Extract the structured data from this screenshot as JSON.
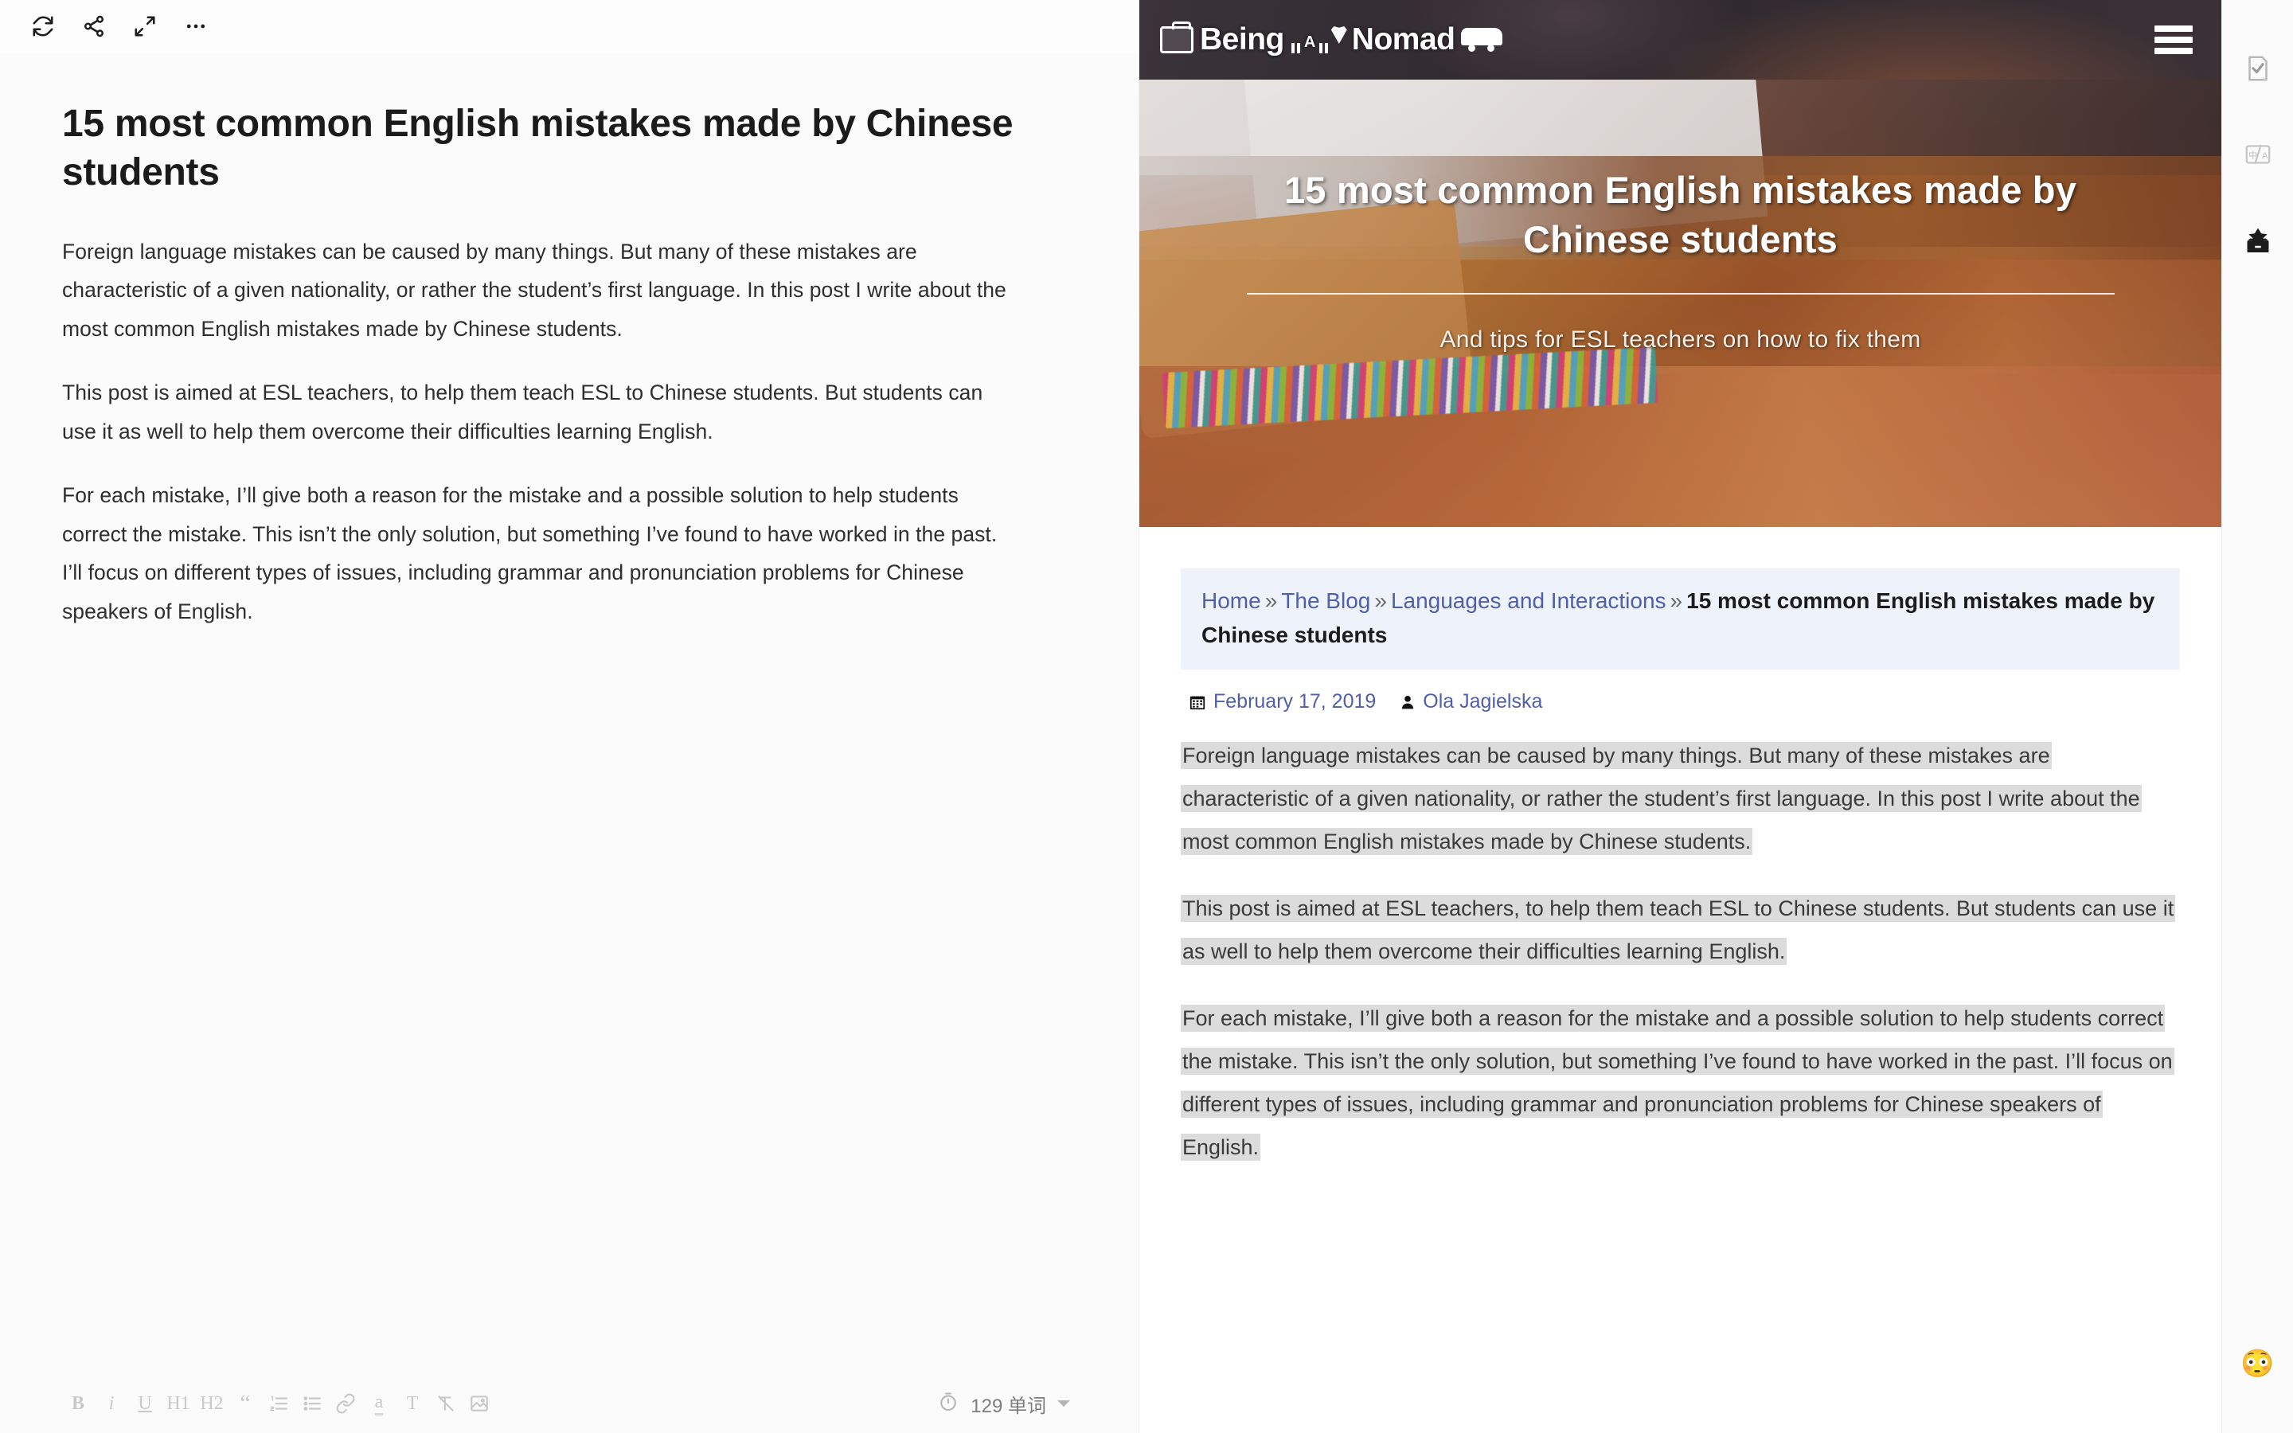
{
  "editor": {
    "toolbar_top": [
      {
        "name": "sync-icon",
        "label": "Sync"
      },
      {
        "name": "share-icon",
        "label": "Share"
      },
      {
        "name": "fullscreen-icon",
        "label": "Fullscreen"
      },
      {
        "name": "more-options-icon",
        "label": "More"
      }
    ],
    "document": {
      "title": "15 most common English mistakes made by Chinese students",
      "paragraphs": [
        "Foreign language mistakes can be caused by many things. But many of these mistakes are characteristic of a given nationality, or rather the student’s first language. In this post I write about the most common English mistakes made by Chinese students.",
        "This post is aimed at ESL teachers, to help them teach ESL to Chinese students. But students can use it as well to help them overcome their difficulties learning English.",
        "For each mistake, I’ll give both a reason for the mistake and a possible solution to help students correct the mistake. This isn’t the only solution, but something I’ve found to have worked in the past. I’ll focus on different types of issues, including grammar and pronunciation problems for Chinese speakers of English."
      ]
    },
    "format_toolbar": [
      {
        "name": "bold-button",
        "label": "B"
      },
      {
        "name": "italic-button",
        "label": "i"
      },
      {
        "name": "underline-button",
        "label": "U"
      },
      {
        "name": "heading-1-button",
        "label": "H1"
      },
      {
        "name": "heading-2-button",
        "label": "H2"
      },
      {
        "name": "blockquote-button",
        "label": "“"
      },
      {
        "name": "ordered-list-button",
        "label": "ordered-list"
      },
      {
        "name": "unordered-list-button",
        "label": "unordered-list"
      },
      {
        "name": "link-button",
        "label": "link"
      },
      {
        "name": "highlight-button",
        "label": "a"
      },
      {
        "name": "text-color-button",
        "label": "T"
      },
      {
        "name": "clear-format-button",
        "label": "clear"
      },
      {
        "name": "insert-image-button",
        "label": "image"
      }
    ],
    "status": {
      "word_count": "129 单词",
      "timer_icon": "timer-icon"
    }
  },
  "preview": {
    "site": {
      "logo_text_1": "Being",
      "logo_text_a": "A",
      "logo_text_2": "Nomad",
      "menu_icon": "hamburger-menu-icon"
    },
    "hero": {
      "title": "15 most common English mistakes made by Chinese students",
      "subtitle": "And tips for ESL teachers on how to fix them"
    },
    "breadcrumb": {
      "items": [
        {
          "label": "Home",
          "link": true
        },
        {
          "label": "The Blog",
          "link": true
        },
        {
          "label": "Languages and Interactions",
          "link": true
        }
      ],
      "separator": "»",
      "current": "15 most common English mistakes made by Chinese students"
    },
    "meta": {
      "date": "February 17, 2019",
      "author": "Ola Jagielska",
      "date_icon": "calendar-icon",
      "author_icon": "user-icon"
    },
    "article_paragraphs": [
      "Foreign language mistakes can be caused by many things. But many of these mistakes are characteristic of a given nationality, or rather the student’s first language. In this post I write about the most common English mistakes made by Chinese students.",
      "This post is aimed at ESL teachers, to help them teach ESL to Chinese students. But students can use it as well to help them overcome their difficulties learning English.",
      "For each mistake, I’ll give both a reason for the mistake and a possible solution to help students correct the mistake. This isn’t the only solution, but something I’ve found to have worked in the past. I’ll focus on different types of issues, including grammar and pronunciation problems for Chinese speakers of English."
    ]
  },
  "rail": {
    "buttons": [
      {
        "name": "document-check-icon",
        "label": "Proofread"
      },
      {
        "name": "translate-icon",
        "label": "Translate"
      },
      {
        "name": "archive-box-icon",
        "label": "Collect"
      }
    ],
    "emoji": "😳"
  },
  "colors": {
    "accent_link": "#4f5fa8",
    "breadcrumb_bg": "#eef2fb",
    "selection_bg": "#dcdcdc",
    "header_bg": "#332e35"
  }
}
